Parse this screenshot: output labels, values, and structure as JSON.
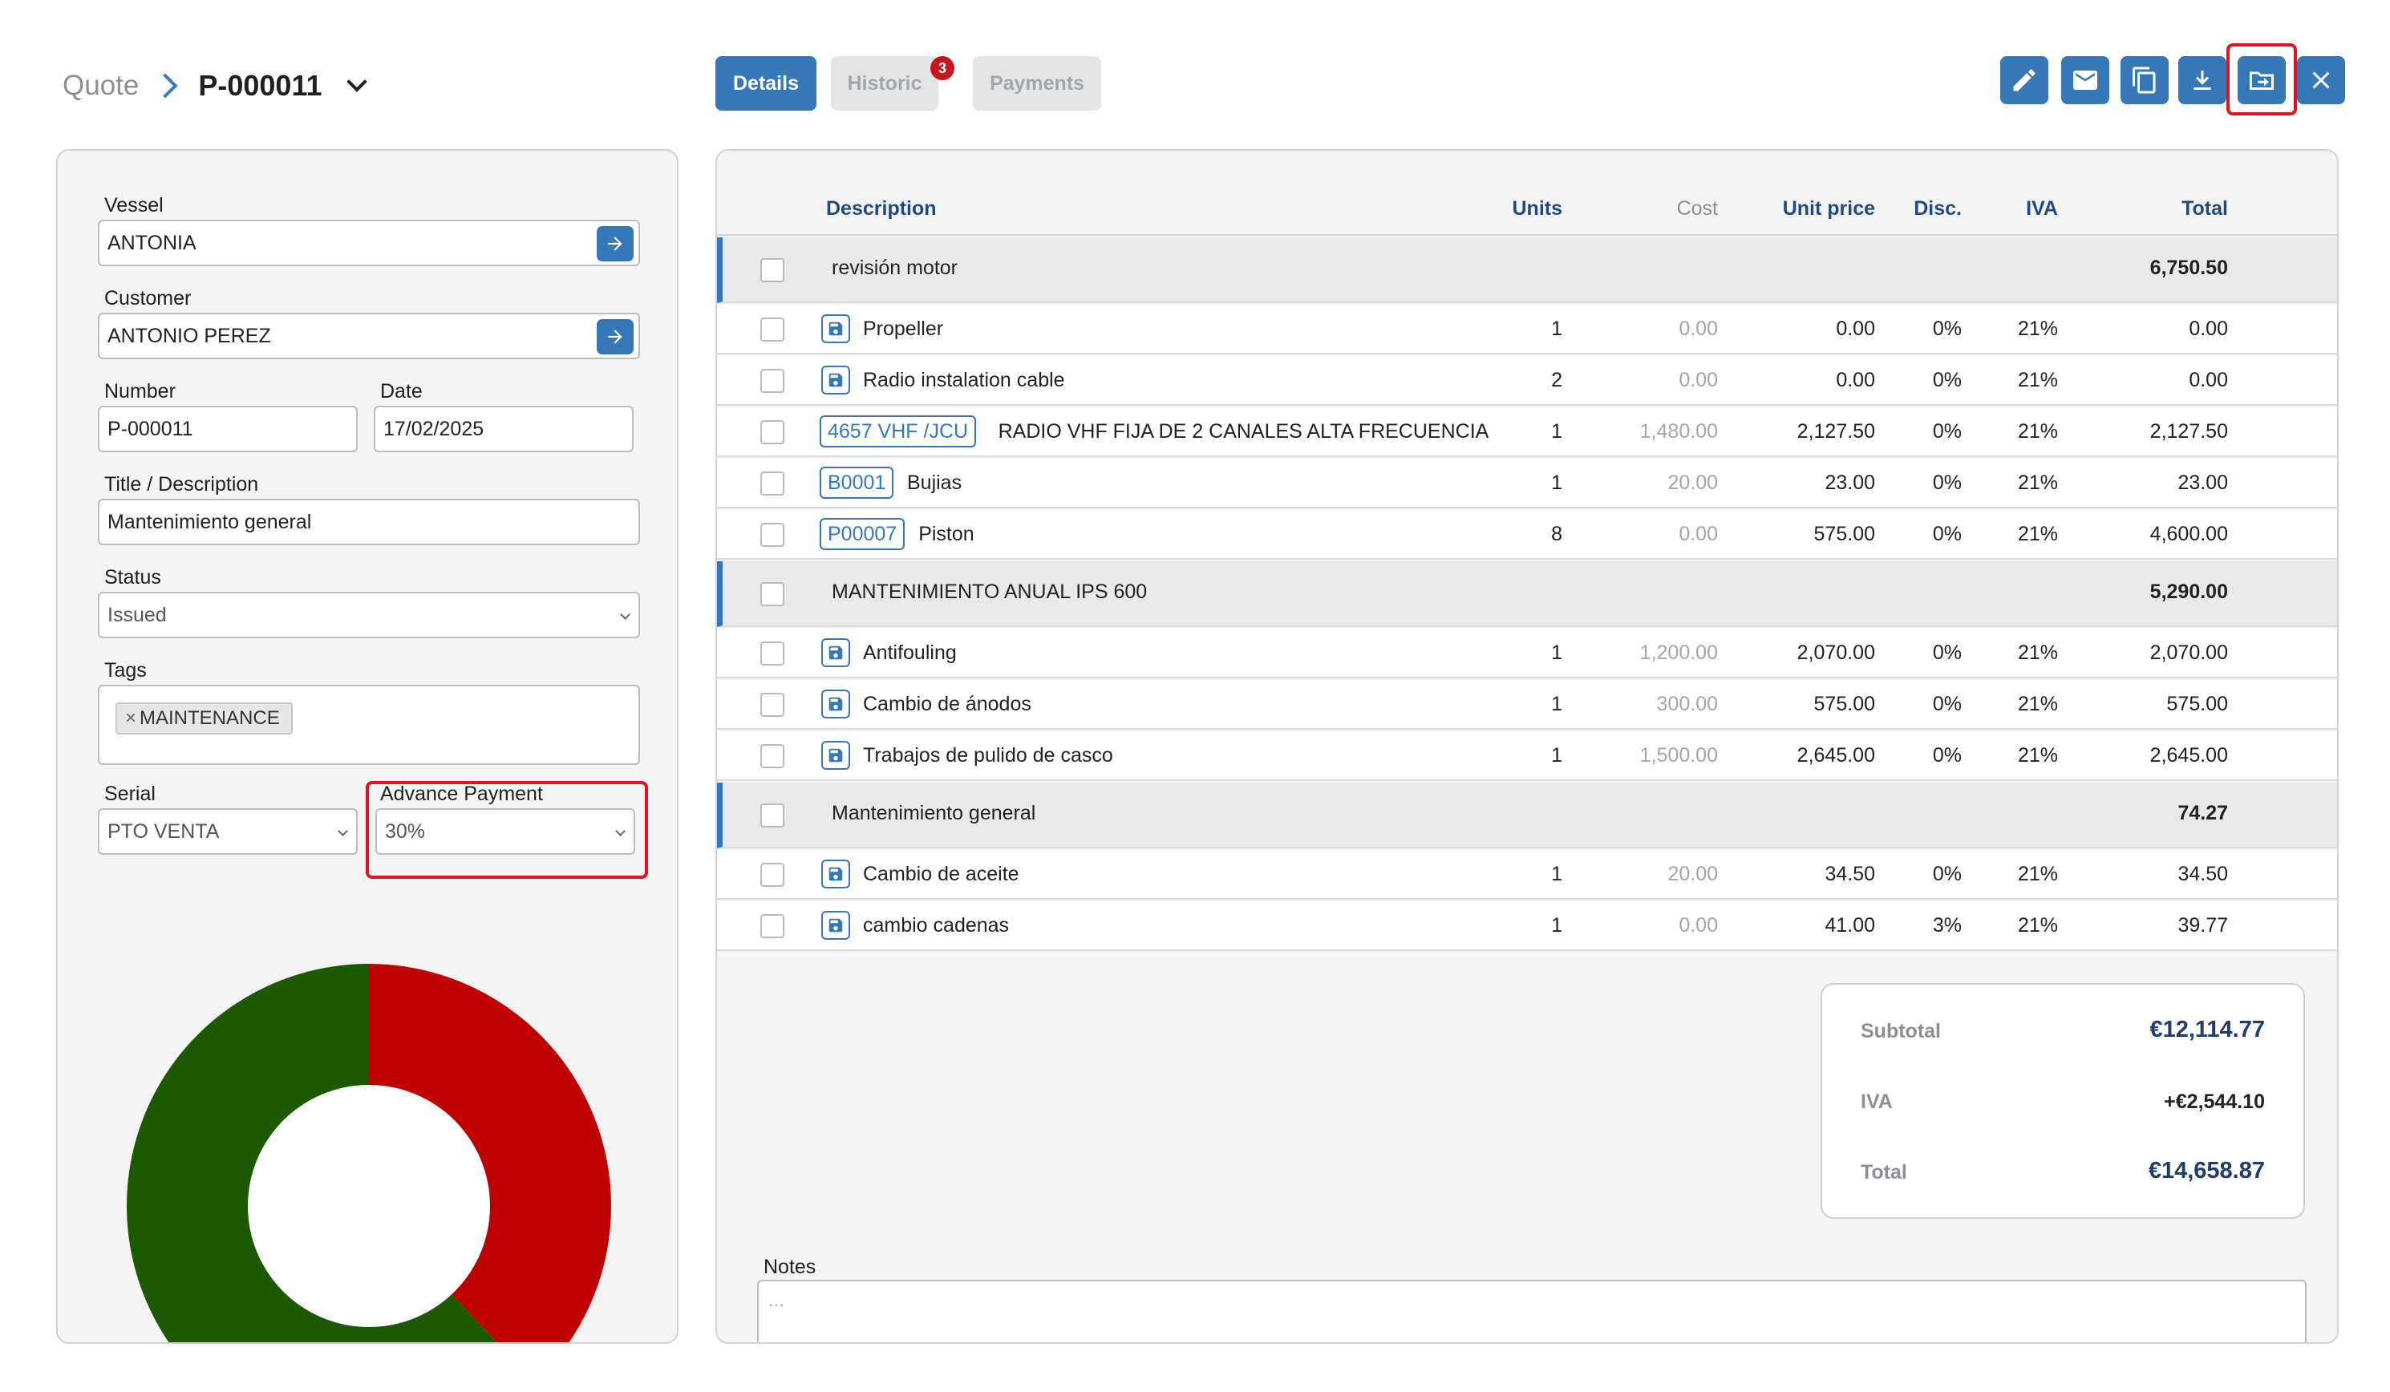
{
  "header": {
    "breadcrumb_root": "Quote",
    "quote_number": "P-000011",
    "tabs": [
      {
        "label": "Details",
        "active": true
      },
      {
        "label": "Historic",
        "badge": "3"
      },
      {
        "label": "Payments"
      }
    ],
    "toolbar": [
      "edit-icon",
      "mail-icon",
      "copy-icon",
      "download-icon",
      "move-to-folder-icon",
      "close-icon"
    ]
  },
  "form": {
    "vessel": {
      "label": "Vessel",
      "value": "ANTONIA"
    },
    "customer": {
      "label": "Customer",
      "value": "ANTONIO PEREZ"
    },
    "number": {
      "label": "Number",
      "value": "P-000011"
    },
    "date": {
      "label": "Date",
      "value": "17/02/2025"
    },
    "title": {
      "label": "Title / Description",
      "value": "Mantenimiento general"
    },
    "status": {
      "label": "Status",
      "value": "Issued"
    },
    "tags": {
      "label": "Tags",
      "items": [
        "MAINTENANCE"
      ],
      "remove_symbol": "×"
    },
    "serial": {
      "label": "Serial",
      "value": "PTO VENTA"
    },
    "advance_payment": {
      "label": "Advance Payment",
      "value": "30%"
    }
  },
  "donut_chart": {
    "slices": [
      {
        "color": "#c00000",
        "fraction": 0.38
      },
      {
        "color": "#1b5a00",
        "fraction": 0.62
      }
    ]
  },
  "table": {
    "columns": {
      "description": "Description",
      "units": "Units",
      "cost": "Cost",
      "unit_price": "Unit price",
      "disc": "Disc.",
      "iva": "IVA",
      "total": "Total"
    },
    "groups": [
      {
        "name": "revisión motor",
        "total": "6,750.50",
        "lines": [
          {
            "code": "",
            "desc": "Propeller",
            "units": "1",
            "cost": "0.00",
            "price": "0.00",
            "disc": "0%",
            "iva": "21%",
            "total": "0.00"
          },
          {
            "code": "",
            "desc": "Radio instalation cable",
            "units": "2",
            "cost": "0.00",
            "price": "0.00",
            "disc": "0%",
            "iva": "21%",
            "total": "0.00"
          },
          {
            "code": "4657 VHF /JCU",
            "desc": "RADIO VHF FIJA DE 2 CANALES ALTA FRECUENCIA",
            "units": "1",
            "cost": "1,480.00",
            "price": "2,127.50",
            "disc": "0%",
            "iva": "21%",
            "total": "2,127.50"
          },
          {
            "code": "B0001",
            "desc": "Bujias",
            "units": "1",
            "cost": "20.00",
            "price": "23.00",
            "disc": "0%",
            "iva": "21%",
            "total": "23.00"
          },
          {
            "code": "P00007",
            "desc": "Piston",
            "units": "8",
            "cost": "0.00",
            "price": "575.00",
            "disc": "0%",
            "iva": "21%",
            "total": "4,600.00"
          }
        ]
      },
      {
        "name": "MANTENIMIENTO ANUAL IPS 600",
        "total": "5,290.00",
        "lines": [
          {
            "code": "",
            "desc": "Antifouling",
            "units": "1",
            "cost": "1,200.00",
            "price": "2,070.00",
            "disc": "0%",
            "iva": "21%",
            "total": "2,070.00"
          },
          {
            "code": "",
            "desc": "Cambio de ánodos",
            "units": "1",
            "cost": "300.00",
            "price": "575.00",
            "disc": "0%",
            "iva": "21%",
            "total": "575.00"
          },
          {
            "code": "",
            "desc": "Trabajos de pulido de casco",
            "units": "1",
            "cost": "1,500.00",
            "price": "2,645.00",
            "disc": "0%",
            "iva": "21%",
            "total": "2,645.00"
          }
        ]
      },
      {
        "name": "Mantenimiento general",
        "total": "74.27",
        "lines": [
          {
            "code": "",
            "desc": "Cambio de aceite",
            "units": "1",
            "cost": "20.00",
            "price": "34.50",
            "disc": "0%",
            "iva": "21%",
            "total": "34.50"
          },
          {
            "code": "",
            "desc": "cambio cadenas",
            "units": "1",
            "cost": "0.00",
            "price": "41.00",
            "disc": "3%",
            "iva": "21%",
            "total": "39.77"
          }
        ]
      }
    ]
  },
  "totals": {
    "subtotal_label": "Subtotal",
    "subtotal": "€12,114.77",
    "iva_label": "IVA",
    "iva": "+€2,544.10",
    "total_label": "Total",
    "total": "€14,658.87"
  },
  "notes": {
    "label": "Notes",
    "placeholder": "..."
  }
}
